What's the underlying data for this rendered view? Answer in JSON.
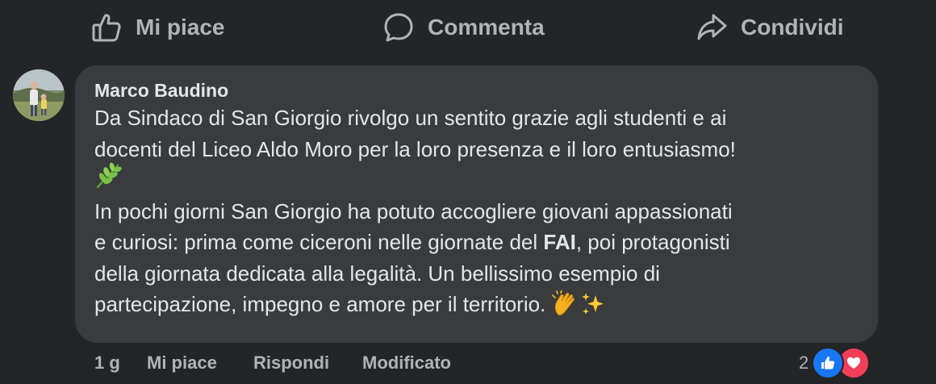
{
  "actions": {
    "like_label": "Mi piace",
    "comment_label": "Commenta",
    "share_label": "Condividi"
  },
  "comment": {
    "author": "Marco Baudino",
    "lines": [
      "Da Sindaco di San Giorgio rivolgo un sentito grazie agli studenti e ai",
      "docenti del Liceo Aldo Moro per la loro presenza e il loro entusiasmo!",
      "In pochi giorni San Giorgio ha potuto accogliere giovani appassionati",
      "e curiosi: prima come ciceroni nelle giornate del ",
      "FAI",
      ", poi protagonisti",
      "della giornata dedicata alla legalità. Un bellissimo esempio di",
      "partecipazione, impegno e amore per il territorio. "
    ],
    "emoji_line3": "herb-emoji",
    "emoji_end": [
      "clapping-hands-emoji",
      "sparkles-emoji"
    ]
  },
  "meta": {
    "time": "1 g",
    "like": "Mi piace",
    "reply": "Rispondi",
    "edited": "Modificato"
  },
  "reactions": {
    "count": "2",
    "types": [
      "like-icon",
      "love-icon"
    ]
  },
  "colors": {
    "background": "#242526",
    "bubble": "#3a3b3c",
    "text_primary": "#e4e6eb",
    "text_secondary": "#b0b3b8",
    "like_blue": "#1877f2",
    "love_red": "#f33e58"
  }
}
